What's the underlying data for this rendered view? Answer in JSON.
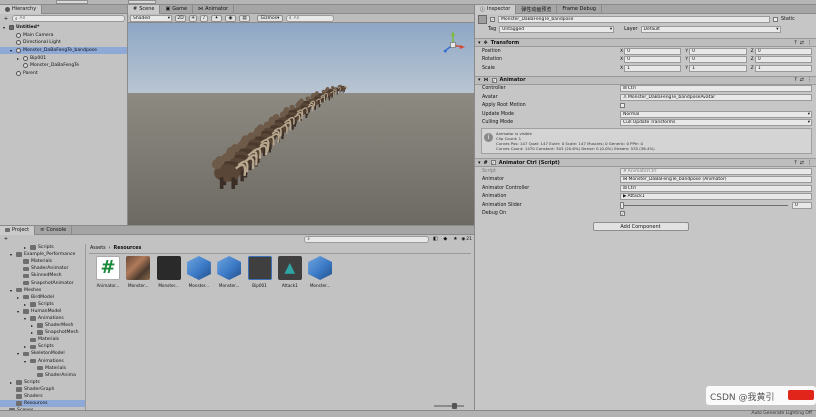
{
  "topbar": {
    "left_label": "",
    "tool_label": ""
  },
  "hierarchy": {
    "tab": "Hierarchy",
    "search_placeholder": "All",
    "items": [
      {
        "label": "Untitled*",
        "indent": 0
      },
      {
        "label": "Main Camera",
        "indent": 1
      },
      {
        "label": "Directional Light",
        "indent": 1
      },
      {
        "label": "Monster_DaBaFengTe_bandpose",
        "indent": 1
      },
      {
        "label": "Bip001",
        "indent": 2
      },
      {
        "label": "Monster_DaBaFengTe",
        "indent": 2
      },
      {
        "label": "Parent",
        "indent": 1
      }
    ]
  },
  "scene": {
    "tabs": [
      "Scene",
      "Game",
      "Animator"
    ],
    "shading": "Shaded",
    "mode2d": "2D",
    "gizmos": "Gizmos",
    "search_placeholder": "All",
    "persp_label": ""
  },
  "project": {
    "tabs": [
      "Project",
      "Console"
    ],
    "breadcrumb_root": "Assets",
    "breadcrumb_sep": "›",
    "breadcrumb_leaf": "Resources",
    "count_label": "21",
    "tree": [
      {
        "label": "Scripts",
        "indent": 3
      },
      {
        "label": "Example_Performance",
        "indent": 1
      },
      {
        "label": "Materials",
        "indent": 2
      },
      {
        "label": "ShaderAnimator",
        "indent": 2
      },
      {
        "label": "SkinnedMesh",
        "indent": 2
      },
      {
        "label": "SnapshotAnimator",
        "indent": 2
      },
      {
        "label": "Meshes",
        "indent": 1
      },
      {
        "label": "BirdModel",
        "indent": 2
      },
      {
        "label": "Scripts",
        "indent": 3
      },
      {
        "label": "HumanModel",
        "indent": 2
      },
      {
        "label": "Animations",
        "indent": 3
      },
      {
        "label": "ShaderMesh",
        "indent": 4
      },
      {
        "label": "SnapshotMesh",
        "indent": 4
      },
      {
        "label": "Materials",
        "indent": 3
      },
      {
        "label": "Scripts",
        "indent": 3
      },
      {
        "label": "SkeletonModel",
        "indent": 2
      },
      {
        "label": "Animations",
        "indent": 3
      },
      {
        "label": "Materials",
        "indent": 4
      },
      {
        "label": "ShaderAnima",
        "indent": 4
      },
      {
        "label": "Scripts",
        "indent": 1
      },
      {
        "label": "ShaderGraph",
        "indent": 1
      },
      {
        "label": "Shaders",
        "indent": 1
      },
      {
        "label": "Resources",
        "indent": 1
      },
      {
        "label": "Scenes",
        "indent": 0
      }
    ],
    "assets": [
      {
        "name": "Animator...",
        "kind": "script"
      },
      {
        "name": "Monster...",
        "kind": "texture"
      },
      {
        "name": "Monster...",
        "kind": "dark"
      },
      {
        "name": "Monster...",
        "kind": "cube"
      },
      {
        "name": "Monster...",
        "kind": "cube"
      },
      {
        "name": "Bip001",
        "kind": "bone"
      },
      {
        "name": "Attack1",
        "kind": "anim"
      },
      {
        "name": "Monster...",
        "kind": "cube"
      }
    ]
  },
  "inspector": {
    "tabs": [
      "Inspector",
      "弹性动画预览",
      "Frame Debug"
    ],
    "object_name": "Monster_DaBaFengTe_bandpose",
    "static_label": "Static",
    "tag_label": "Tag",
    "tag_value": "Untagged",
    "layer_label": "Layer",
    "layer_value": "Default",
    "transform": {
      "title": "Transform",
      "rows": [
        {
          "label": "Position",
          "x": "0",
          "y": "0",
          "z": "0"
        },
        {
          "label": "Rotation",
          "x": "0",
          "y": "0",
          "z": "0"
        },
        {
          "label": "Scale",
          "x": "1",
          "y": "1",
          "z": "1"
        }
      ]
    },
    "animator": {
      "title": "Animator",
      "controller_label": "Controller",
      "controller_value": "Ctrl",
      "avatar_label": "Avatar",
      "avatar_value": "Monster_DaBaFengTe_bandposeAvatar",
      "root_motion_label": "Apply Root Motion",
      "update_mode_label": "Update Mode",
      "update_mode_value": "Normal",
      "culling_mode_label": "Culling Mode",
      "culling_mode_value": "Cull Update Transforms",
      "info_lines": [
        "Animator is visible",
        "Clip Count: 1",
        "Curves Pos: 147 Quat: 147 Euler: 0 Scale: 147 Muscles: 0 Generic: 0 PPtr: 0",
        "Curves Count: 1470 Constant: 303 (20.6%) Dense: 0 (0.0%) Stream: 535 (36.4%)"
      ]
    },
    "ctrl": {
      "title": "Animator Ctrl (Script)",
      "script_label": "Script",
      "script_value": "AnimatorCtrl",
      "animator_label": "Animator",
      "animator_value": "Monster_DaBaFengTe_bandpose (Animator)",
      "controller_label": "Animator Controller",
      "controller_value": "Ctrl",
      "animation_label": "Animation",
      "animation_value": "Attack1",
      "slider_label": "Animation Slider",
      "slider_value": "0",
      "slider_fraction": 0,
      "debug_label": "Debug On",
      "debug_checked": true
    },
    "add_component": "Add Component"
  },
  "footer": {
    "autogen": "Auto Generate Lighting Off",
    "watermark": "CSDN @我黄引"
  },
  "colors": {
    "sky": "#8fa6c3",
    "ground": "#7d7b75",
    "selection": "#3d6fb6",
    "cube": "#3b7ac6"
  }
}
